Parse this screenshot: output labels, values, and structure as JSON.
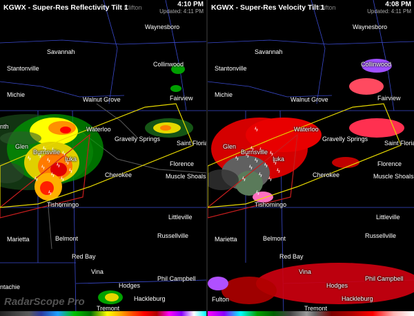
{
  "left_panel": {
    "title": "KGWX - Super-Res Reflectivity Tilt 1",
    "time": "4:10 PM",
    "updated": "Updated: 4:11 PM",
    "watermark": "RadarScope Pro",
    "cities": {
      "clifton": "Clifton",
      "waynesboro": "Waynesboro",
      "savannah": "Savannah",
      "stantonville": "Stantonville",
      "collinwood": "Collinwood",
      "michie": "Michie",
      "fairview": "Fairview",
      "walnut_grove": "Walnut Grove",
      "nth": "nth",
      "waterloo": "Waterloo",
      "gravelly_springs": "Gravelly Springs",
      "saint_florian": "Saint Florian",
      "glen": "Glen",
      "burnsville": "Burnsville",
      "iuka": "Iuka",
      "florence": "Florence",
      "cherokee": "Cherokee",
      "muscle_shoals": "Muscle Shoals",
      "tishomingo": "Tishomingo",
      "littleville": "Littleville",
      "marietta": "Marietta",
      "belmont": "Belmont",
      "russellville": "Russellville",
      "red_bay": "Red Bay",
      "vina": "Vina",
      "phil_campbell": "Phil Campbell",
      "ntachie": "ntachie",
      "hodges": "Hodges",
      "hackleburg": "Hackleburg",
      "tremont": "Tremont"
    }
  },
  "right_panel": {
    "title": "KGWX - Super-Res Velocity Tilt 1",
    "time": "4:08 PM",
    "updated": "Updated: 4:11 PM",
    "cities": {
      "clifton": "Clifton",
      "waynesboro": "Waynesboro",
      "savannah": "Savannah",
      "stantonville": "Stantonville",
      "collinwood": "Collinwood",
      "michie": "Michie",
      "fairview": "Fairview",
      "walnut_grove": "Walnut Grove",
      "waterloo": "Waterloo",
      "gravelly_springs": "Gravelly Springs",
      "saint_florian": "Saint Florian",
      "glen": "Glen",
      "burnsville": "Burnsville",
      "iuka": "Iuka",
      "florence": "Florence",
      "cherokee": "Cherokee",
      "muscle_shoals": "Muscle Shoals",
      "tishomingo": "Tishomingo",
      "littleville": "Littleville",
      "marietta": "Marietta",
      "belmont": "Belmont",
      "russellville": "Russellville",
      "red_bay": "Red Bay",
      "vina": "Vina",
      "phil_campbell": "Phil Campbell",
      "fulton": "Fulton",
      "hodges": "Hodges",
      "hackleburg": "Hackleburg",
      "tremont": "Tremont"
    }
  },
  "colors": {
    "warning_polygon_yellow": "#e6d800",
    "warning_polygon_red": "#c81e1e",
    "county_lines": "#3b4bd0",
    "roads": "#666666"
  },
  "icons": [
    "lightning-icon"
  ]
}
